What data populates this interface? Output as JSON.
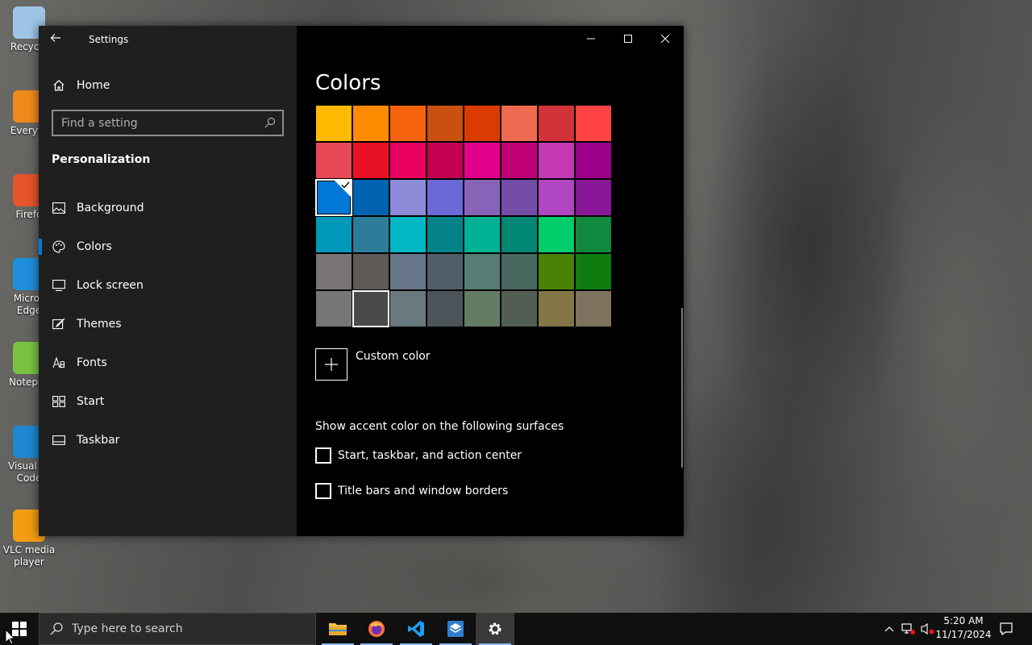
{
  "desktop": {
    "icons": [
      {
        "label": "Recycle",
        "color": "#9ec5e6"
      },
      {
        "label": "Everyth",
        "color": "#f08a1c"
      },
      {
        "label": "Firefo",
        "color": "#e8542c"
      },
      {
        "label": "Micros Edge",
        "color": "#1f8fdc"
      },
      {
        "label": "Notepac",
        "color": "#7bc243"
      },
      {
        "label": "Visual St Code",
        "color": "#1e88d2"
      },
      {
        "label": "VLC media player",
        "color": "#f39c12"
      }
    ]
  },
  "window": {
    "title": "Settings",
    "nav": {
      "home_label": "Home",
      "search_placeholder": "Find a setting",
      "section_title": "Personalization",
      "items": [
        {
          "label": "Background",
          "icon": "picture-icon"
        },
        {
          "label": "Colors",
          "icon": "palette-icon",
          "active": true
        },
        {
          "label": "Lock screen",
          "icon": "lock-screen-icon"
        },
        {
          "label": "Themes",
          "icon": "brush-icon"
        },
        {
          "label": "Fonts",
          "icon": "font-icon"
        },
        {
          "label": "Start",
          "icon": "start-grid-icon"
        },
        {
          "label": "Taskbar",
          "icon": "taskbar-icon"
        }
      ]
    },
    "main": {
      "page_title": "Colors",
      "accent_colors": [
        [
          "#FFB900",
          "#FF8C00",
          "#F7630C",
          "#CA5010",
          "#DA3B01",
          "#EF6950",
          "#D13438",
          "#FF4343"
        ],
        [
          "#E74856",
          "#E81123",
          "#EA005E",
          "#C30052",
          "#E3008C",
          "#BF0077",
          "#C239B3",
          "#9A0089"
        ],
        [
          "#0078D7",
          "#0063B1",
          "#8E8CD8",
          "#6B69D6",
          "#8764B8",
          "#744DA9",
          "#B146C2",
          "#881798"
        ],
        [
          "#0099BC",
          "#2D7D9A",
          "#00B7C3",
          "#038387",
          "#00B294",
          "#018574",
          "#00CC6A",
          "#10893E"
        ],
        [
          "#7A7574",
          "#5D5A58",
          "#68768A",
          "#515C6B",
          "#567C73",
          "#486860",
          "#498205",
          "#107C10"
        ],
        [
          "#767676",
          "#4C4A48",
          "#69797E",
          "#4A5459",
          "#647C64",
          "#525E54",
          "#847545",
          "#7E735F"
        ]
      ],
      "selected_color": "#0078D7",
      "custom_color_label": "Custom color",
      "surfaces_title": "Show accent color on the following surfaces",
      "checkboxes": [
        {
          "label": "Start, taskbar, and action center",
          "checked": false
        },
        {
          "label": "Title bars and window borders",
          "checked": false
        }
      ]
    }
  },
  "taskbar": {
    "search_placeholder": "Type here to search",
    "time": "5:20 AM",
    "date": "11/17/2024"
  }
}
